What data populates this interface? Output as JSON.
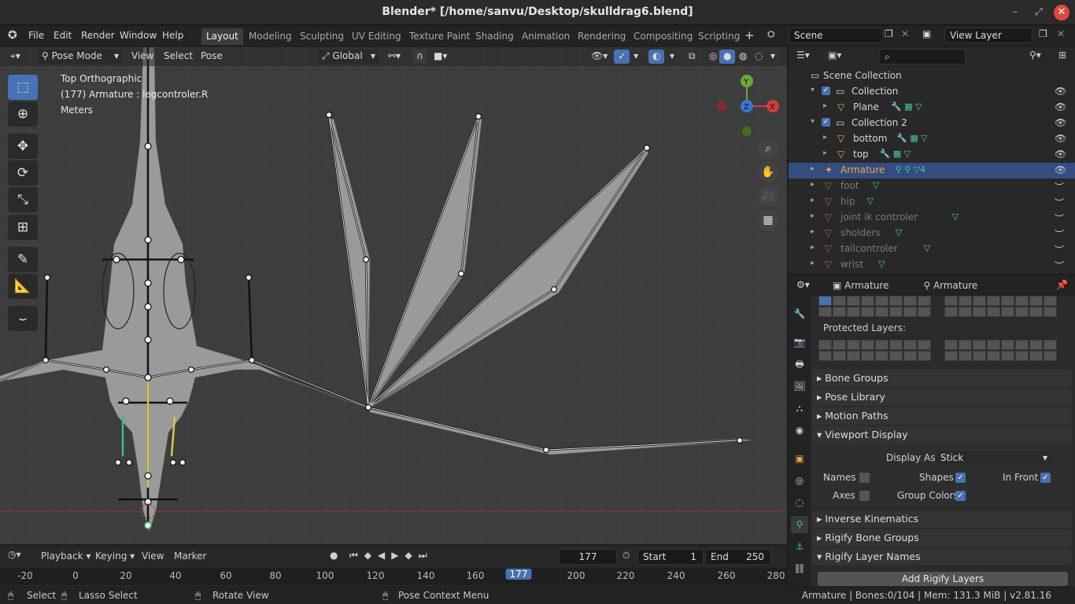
{
  "window": {
    "title": "Blender* [/home/sanvu/Desktop/skulldrag6.blend]"
  },
  "menu": {
    "items": [
      "File",
      "Edit",
      "Render",
      "Window",
      "Help"
    ]
  },
  "workspaces": [
    "Layout",
    "Modeling",
    "Sculpting",
    "UV Editing",
    "Texture Paint",
    "Shading",
    "Animation",
    "Rendering",
    "Compositing",
    "Scripting"
  ],
  "active_workspace": "Layout",
  "scene": {
    "name": "Scene",
    "view_layer": "View Layer"
  },
  "viewport": {
    "mode": "Pose Mode",
    "menus": [
      "View",
      "Select",
      "Pose"
    ],
    "orientation": "Global",
    "overlay_lines": [
      "Top Orthographic",
      "(177) Armature : legcontroler.R",
      "Meters"
    ],
    "gizmo": {
      "y": "Y",
      "z": "Z",
      "x": "X"
    }
  },
  "timeline": {
    "menus": [
      "Playback",
      "Keying",
      "View",
      "Marker"
    ],
    "current_frame": "177",
    "start_label": "Start",
    "start": "1",
    "end_label": "End",
    "end": "250",
    "ruler": [
      "-20",
      "0",
      "20",
      "40",
      "60",
      "80",
      "100",
      "120",
      "140",
      "160",
      "177",
      "200",
      "220",
      "240",
      "260",
      "280"
    ]
  },
  "outliner": {
    "root": "Scene Collection",
    "rows": [
      {
        "label": "Collection",
        "type": "collection"
      },
      {
        "label": "Plane",
        "type": "mesh"
      },
      {
        "label": "Collection 2",
        "type": "collection"
      },
      {
        "label": "bottom",
        "type": "mesh"
      },
      {
        "label": "top",
        "type": "mesh"
      },
      {
        "label": "Armature",
        "type": "armature",
        "badge": "4"
      },
      {
        "label": "foot",
        "type": "mesh"
      },
      {
        "label": "hip",
        "type": "mesh"
      },
      {
        "label": "joint ik controler",
        "type": "mesh"
      },
      {
        "label": "sholders",
        "type": "mesh"
      },
      {
        "label": "tailcontroler",
        "type": "mesh"
      },
      {
        "label": "wrist",
        "type": "mesh"
      }
    ]
  },
  "properties": {
    "breadcrumb": [
      "Armature",
      "Armature"
    ],
    "protected_layers_label": "Protected Layers:",
    "panels_top": [
      "Bone Groups",
      "Pose Library",
      "Motion Paths",
      "Viewport Display"
    ],
    "display_as_label": "Display As",
    "display_as_value": "Stick",
    "checks": {
      "names": "Names",
      "shapes": "Shapes",
      "in_front": "In Front",
      "axes": "Axes",
      "group_colors": "Group Colors"
    },
    "panels_bottom": [
      "Inverse Kinematics",
      "Rigify Bone Groups",
      "Rigify Layer Names"
    ],
    "add_rigify_layers": "Add Rigify Layers"
  },
  "statusbar": {
    "select": "Select",
    "lasso": "Lasso Select",
    "rotate": "Rotate View",
    "context": "Pose Context Menu",
    "info": "Armature | Bones:0/104 | Mem: 131.3 MiB | v2.81.16"
  },
  "colors": {
    "accent": "#4772b3",
    "selected_row": "#334d80",
    "armature_text": "#e8a948",
    "close": "#e0483e"
  }
}
